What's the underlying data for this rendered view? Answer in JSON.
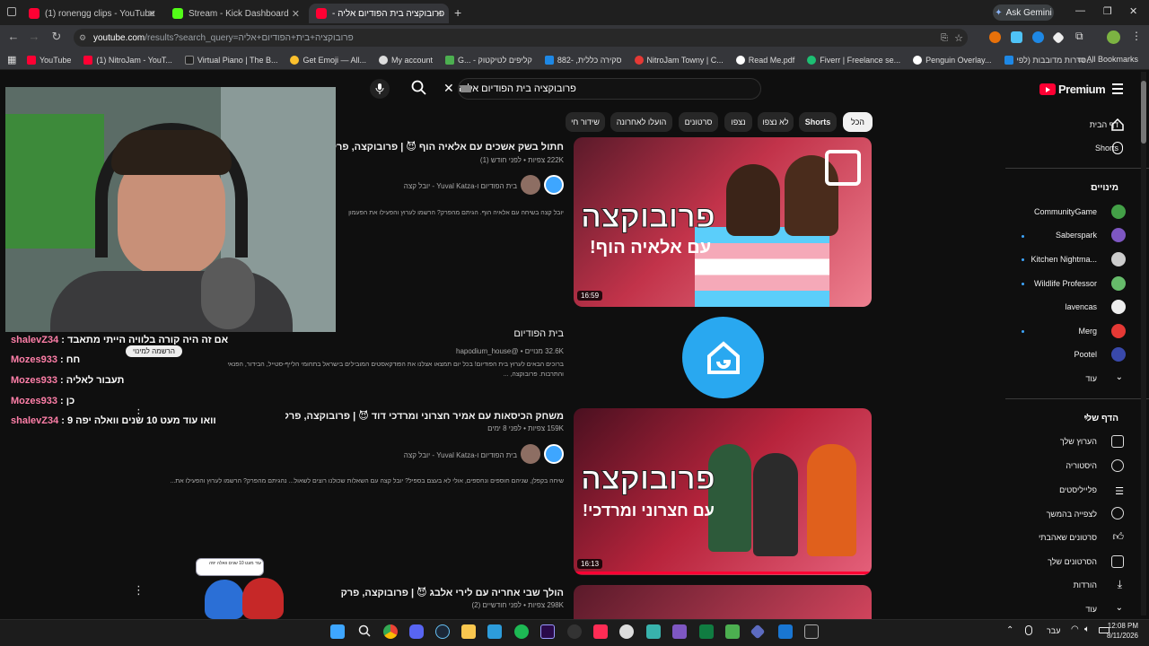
{
  "browser": {
    "tabs": [
      {
        "label": "(1) ronengg clips - YouTube",
        "active": false
      },
      {
        "label": "Stream - Kick Dashboard",
        "active": false
      },
      {
        "label": "פרובוקציה בית הפודיום אליה -",
        "active": true
      }
    ],
    "ask_gemini": "Ask Gemini",
    "url_host": "youtube.com",
    "url_path": "/results?search_query=פרובוקציה+בית+הפודיום+אליה",
    "bookmarks": [
      "YouTube",
      "(1) NitroJam - YouT...",
      "Virtual Piano | The B...",
      "Get Emoji — All...",
      "My account",
      "G... - קליפים לטיקטוק",
      "882- ,סקירה כללית",
      "NitroJam Towny | C...",
      "Read Me.pdf",
      "Fiverr | Freelance se...",
      "Penguin Overlay...",
      "סדרות מדובבות (לפי..."
    ],
    "all_bookmarks": "All Bookmarks"
  },
  "youtube": {
    "logo": "Premium",
    "search_query": "פרובוקציה בית הפודיום אליה",
    "chips": [
      "הכל",
      "Shorts",
      "לא נצפו",
      "נצפו",
      "סרטונים",
      "הועלו לאחרונה",
      "שידור חי"
    ],
    "results": [
      {
        "title": "חתול בשק אשכים עם אלאיה הוף 😈 | פרובוקצה, פרק 5",
        "meta": "222K צפיות • לפני חודש (1)",
        "channel": "בית הפודיום ו-Yuval Katza - יובל קצה",
        "description": "יובל קצה בשיחה עם אלאיה הוף. הגיתם מהפרק? הרשמו לערוץ והפעילו את הפעמון",
        "duration": "16:59",
        "thumb_line1": "פרובוקצה",
        "thumb_line2": "עם אלאיה הוף!"
      },
      {
        "title": "משחק הכיסאות עם אמיר חצרוני ומרדכי דוד 😈 | פרובוקצה, פרק 9",
        "meta": "159K צפיות • לפני 8 ימים",
        "channel": "בית הפודיום ו-Yuval Katza - יובל קצה",
        "description": "שיחה בקפלן, שניהם חוספים ונחספים, אולי לא בעצם בספיל? יובל קצה עם השאלות שכולנו רוצים לשאול... נהגיתם מהפרק? הרשמו לערוץ והפעילו את...",
        "duration": "16:13",
        "thumb_line1": "פרובוקצה",
        "thumb_line2": "עם חצרוני ומרדכי!"
      },
      {
        "title": "הולך שבי אחריה עם לירי אלבג 😈 | פרובוקצה, פרק 1",
        "meta": "298K צפיות • לפני חודשיים (2)"
      }
    ],
    "channel_result": {
      "name": "בית הפודיום",
      "meta": "32.6K מנויים • @hapodium_house",
      "description": "ברוכים הבאים לערוץ בית הפודיום! בכל יום תמצאו אצלנו את הפודקאסטים המובילים בישראל בתחומי הלייף-סטייל, הבידור, הפנאי והתרבות. פרובוקצה, ..."
    },
    "sidebar": {
      "home": "דף הבית",
      "shorts": "Shorts",
      "subs_title": "מינויים",
      "subs": [
        "CommunityGame",
        "Saberspark",
        "Kitchen Nightma...",
        "Wildlife Professor",
        "lavencas",
        "Merg",
        "Pootel"
      ],
      "more1": "עוד",
      "you_title": "הדף שלי",
      "you_items": [
        "הערוץ שלך",
        "היסטוריה",
        "פלייליסטים",
        "לצפייה בהמשך",
        "סרטונים שאהבתי",
        "הסרטונים שלך",
        "הורדות"
      ],
      "more2": "עוד"
    },
    "subscribe_tooltip": "הרשמה למינוי"
  },
  "chat": [
    {
      "user": "shalevZ34",
      "msg": "אם זה היה קורה בלוויה הייתי מתאבד"
    },
    {
      "user": "Mozes933",
      "msg": "חח"
    },
    {
      "user": "Mozes933",
      "msg": "תעבור לאליה"
    },
    {
      "user": "Mozes933",
      "msg": "כן"
    },
    {
      "user": "shalevZ34",
      "msg": "וואו עוד מעט 10 שנים וואלה יפה 9"
    }
  ],
  "overlay": {
    "bubble_text": "עוד מעט 10 שנים וואלה יפה"
  },
  "taskbar": {
    "lang": "עבר",
    "time": "12:08 PM",
    "date": "8/11/2026"
  }
}
